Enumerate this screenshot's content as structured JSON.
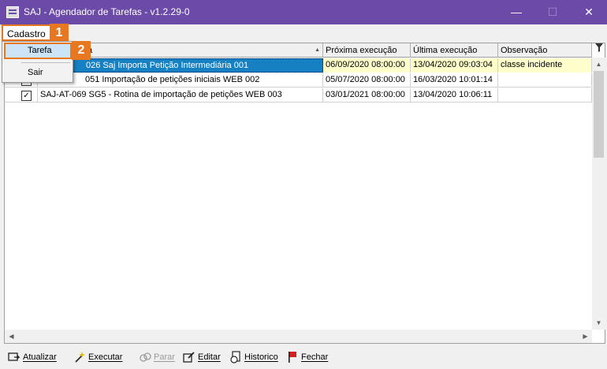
{
  "window": {
    "title": "SAJ - Agendador de Tarefas - v1.2.29-0",
    "controls": {
      "minimize": "—",
      "maximize": "☐",
      "close": "✕"
    }
  },
  "menu": {
    "cadastro": "Cadastro",
    "dropdown": {
      "tarefa": "Tarefa",
      "sair": "Sair"
    }
  },
  "callouts": {
    "one": "1",
    "two": "2"
  },
  "grid": {
    "columns": [
      "fa",
      "Próxima execução",
      "Última execução",
      "Observação"
    ],
    "rows": [
      {
        "checked": false,
        "desc": "026 Saj Importa Petição Intermediária 001",
        "next": "06/09/2020 08:00:00",
        "last": "13/04/2020 09:03:04",
        "obs": "classe incidente"
      },
      {
        "checked": false,
        "desc": "051 Importação de petições iniciais WEB 002",
        "next": "05/07/2020 08:00:00",
        "last": "16/03/2020 10:01:14",
        "obs": ""
      },
      {
        "checked": true,
        "check_mark": "✓",
        "desc": "SAJ-AT-069 SG5 - Rotina de importação de petições WEB 003",
        "next": "03/01/2021 08:00:00",
        "last": "13/04/2020 10:06:11",
        "obs": ""
      }
    ]
  },
  "toolbar": {
    "atualizar": "Atualizar",
    "executar": "Executar",
    "parar": "Parar",
    "editar": "Editar",
    "historico": "Historico",
    "fechar": "Fechar"
  },
  "colors": {
    "titlebar": "#6b4aa8",
    "callout": "#e87722",
    "selection": "#1681c2",
    "highlight": "#ffffcc"
  }
}
